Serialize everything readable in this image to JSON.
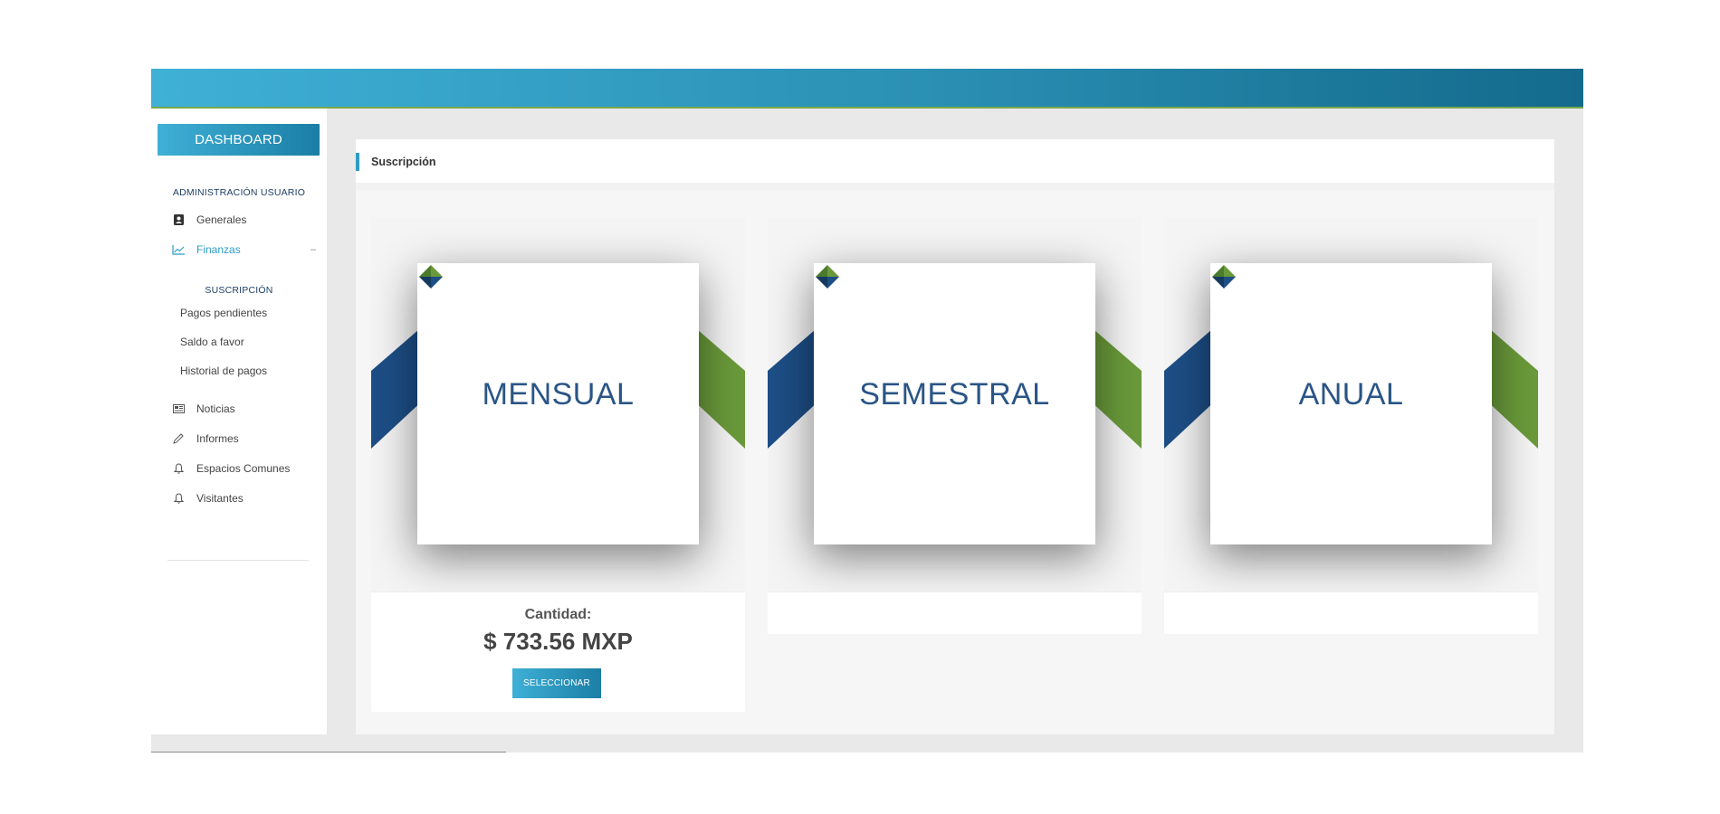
{
  "sidebar": {
    "dashboard_label": "DASHBOARD",
    "admin_section": "ADMINISTRACIÓN USUARIO",
    "items": [
      {
        "label": "Generales",
        "icon": "user-card-icon"
      },
      {
        "label": "Finanzas",
        "icon": "line-chart-icon",
        "expanded_marker": "–"
      }
    ],
    "subscription_section": "SUSCRIPCIÓN",
    "sub_items": [
      "Pagos pendientes",
      "Saldo a favor",
      "Historial de pagos"
    ],
    "more_items": [
      {
        "label": "Noticias",
        "icon": "newspaper-icon"
      },
      {
        "label": "Informes",
        "icon": "pencil-icon"
      },
      {
        "label": "Espacios Comunes",
        "icon": "bell-icon"
      },
      {
        "label": "Visitantes",
        "icon": "bell-icon"
      }
    ]
  },
  "panel": {
    "title": "Suscripción"
  },
  "plans": [
    {
      "name": "MENSUAL",
      "quantity_label": "Cantidad:",
      "price": "$ 733.56 MXP",
      "button": "SELECCIONAR"
    },
    {
      "name": "SEMESTRAL"
    },
    {
      "name": "ANUAL"
    }
  ],
  "colors": {
    "brand_light": "#3fb0d6",
    "brand_dark": "#136a8c",
    "ribbon_blue": "#1d4e86",
    "ribbon_green": "#6a9a3a",
    "plan_text": "#2a5586"
  }
}
